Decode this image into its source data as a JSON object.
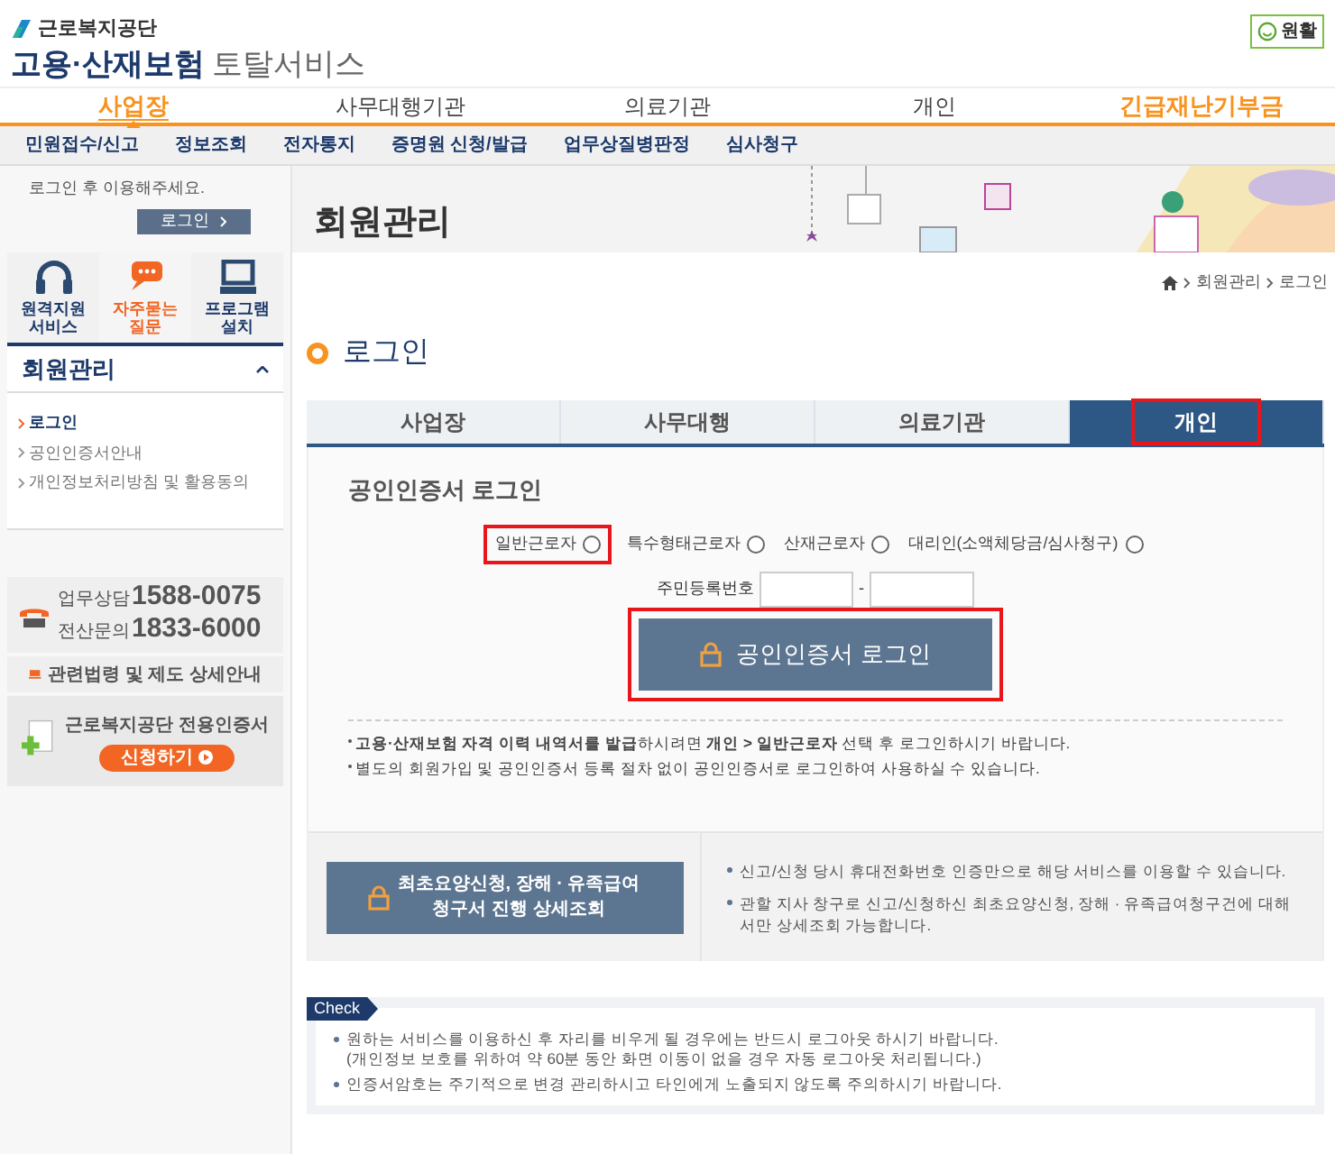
{
  "header": {
    "org": "근로복지공단",
    "title_bold": "고용·산재보험",
    "title_rest": "토탈서비스",
    "status_badge": "원활"
  },
  "main_nav": [
    {
      "label": "사업장",
      "selected": true,
      "kind": "primary"
    },
    {
      "label": "사무대행기관",
      "selected": false,
      "kind": "normal"
    },
    {
      "label": "의료기관",
      "selected": false,
      "kind": "normal"
    },
    {
      "label": "개인",
      "selected": false,
      "kind": "normal"
    },
    {
      "label": "긴급재난기부금",
      "selected": false,
      "kind": "primary"
    }
  ],
  "sub_nav": [
    "민원접수/신고",
    "정보조회",
    "전자통지",
    "증명원 신청/발급",
    "업무상질병판정",
    "심사청구"
  ],
  "sidebar": {
    "login_prompt": "로그인 후 이용해주세요.",
    "login_button": "로그인",
    "quick_links": [
      {
        "label": "원격지원 서비스",
        "kind": "headset"
      },
      {
        "label": "자주묻는 질문",
        "kind": "chat"
      },
      {
        "label": "프로그램 설치",
        "kind": "monitor"
      }
    ],
    "section_title": "회원관리",
    "items": [
      {
        "label": "로그인",
        "selected": true
      },
      {
        "label": "공인인증서안내",
        "selected": false
      },
      {
        "label": "개인정보처리방침 및 활용동의",
        "selected": false
      }
    ],
    "phones": [
      {
        "label": "업무상담",
        "number": "1588-0075"
      },
      {
        "label": "전산문의",
        "number": "1833-6000"
      }
    ],
    "law_link": "관련법령 및 제도 상세안내",
    "cert_title": "근로복지공단 전용인증서",
    "cert_button": "신청하기"
  },
  "banner": {
    "title": "회원관리"
  },
  "breadcrumb": [
    "회원관리",
    "로그인"
  ],
  "page_title": "로그인",
  "tabs": [
    {
      "label": "사업장",
      "selected": false,
      "highlighted": false
    },
    {
      "label": "사무대행",
      "selected": false,
      "highlighted": false
    },
    {
      "label": "의료기관",
      "selected": false,
      "highlighted": false
    },
    {
      "label": "개인",
      "selected": true,
      "highlighted": true
    }
  ],
  "login": {
    "title": "공인인증서 로그인",
    "user_types": [
      {
        "label": "일반근로자",
        "selected": false,
        "highlighted": true
      },
      {
        "label": "특수형태근로자",
        "selected": false,
        "highlighted": false
      },
      {
        "label": "산재근로자",
        "selected": false,
        "highlighted": false
      },
      {
        "label": "대리인(소액체당금/심사청구)",
        "selected": false,
        "highlighted": false
      }
    ],
    "ssn_label": "주민등록번호",
    "ssn_separator": "-",
    "button": {
      "label": "공인인증서 로그인",
      "highlighted": true
    },
    "notes": [
      "**고용·산재보험 자격 이력 내역서를 발급**하시려면 **개인 > 일반근로자** 선택 후 로그인하시기 바랍니다.",
      "별도의 회원가입 및 공인인증서 등록 절차 없이 공인인증서로 로그인하여 사용하실 수 있습니다."
    ]
  },
  "claim": {
    "button_lines": [
      "최초요양신청, 장해 · 유족급여",
      "청구서 진행 상세조회"
    ],
    "notes": [
      "신고/신청 당시 휴대전화번호 인증만으로 해당 서비스를 이용할 수 있습니다.",
      "관할 지사 창구로 신고/신청하신 최초요양신청, 장해 · 유족급여청구건에 대해서만 상세조회 가능합니다."
    ]
  },
  "check": {
    "label": "Check",
    "items": [
      "원하는 서비스를 이용하신 후 자리를 비우게 될 경우에는 반드시 로그아웃 하시기 바랍니다.\n(개인정보 보호를 위하여 약 60분 동안 화면 이동이 없을 경우 자동 로그아웃 처리됩니다.)",
      "인증서암호는 주기적으로 변경 관리하시고 타인에게 노출되지 않도록 주의하시기 바랍니다."
    ]
  }
}
